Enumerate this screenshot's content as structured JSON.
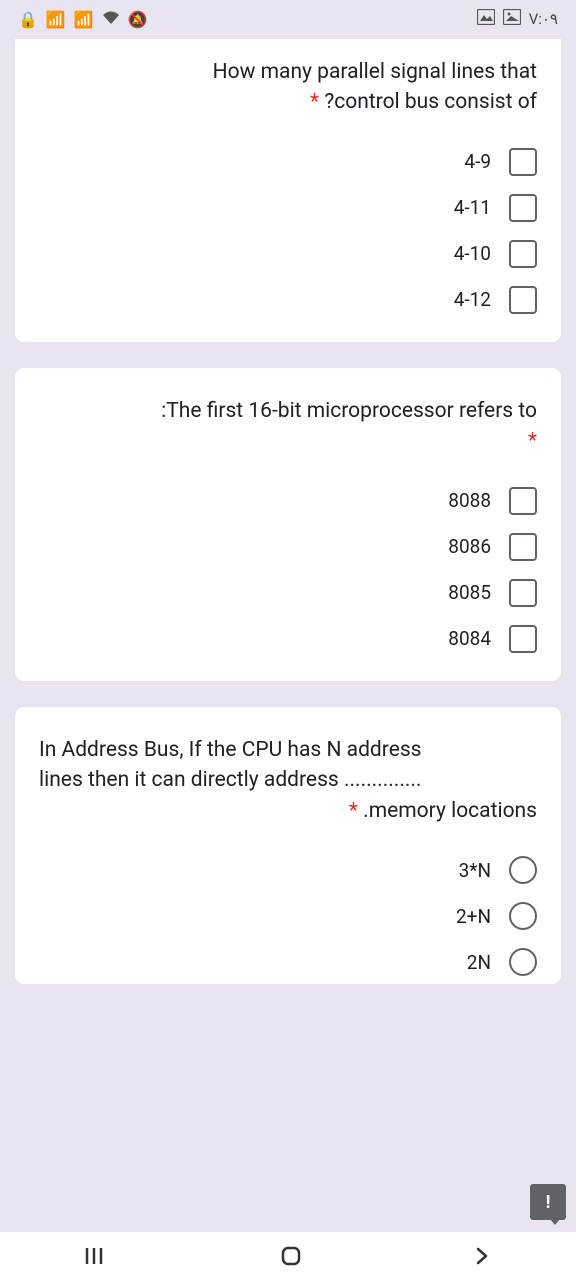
{
  "status": {
    "time": "V:٠٩",
    "signal": "📶",
    "wifi": "📡"
  },
  "questions": [
    {
      "text_line1": "How many parallel signal lines that",
      "text_line2": "?control bus consist of",
      "required": "*",
      "type": "checkbox",
      "options": [
        "4-9",
        "4-11",
        "4-10",
        "4-12"
      ]
    },
    {
      "text_line1": ":The first 16-bit microprocessor refers to",
      "text_line2": "",
      "required": "*",
      "type": "checkbox",
      "options": [
        "8088",
        "8086",
        "8085",
        "8084"
      ]
    },
    {
      "text_line1": "In Address Bus, If the CPU has N address",
      "text_line2": "lines then it can directly address ..............",
      "text_line3": ".memory locations",
      "required": "*",
      "type": "radio",
      "options": [
        "3*N",
        "2+N",
        "2N"
      ]
    }
  ]
}
